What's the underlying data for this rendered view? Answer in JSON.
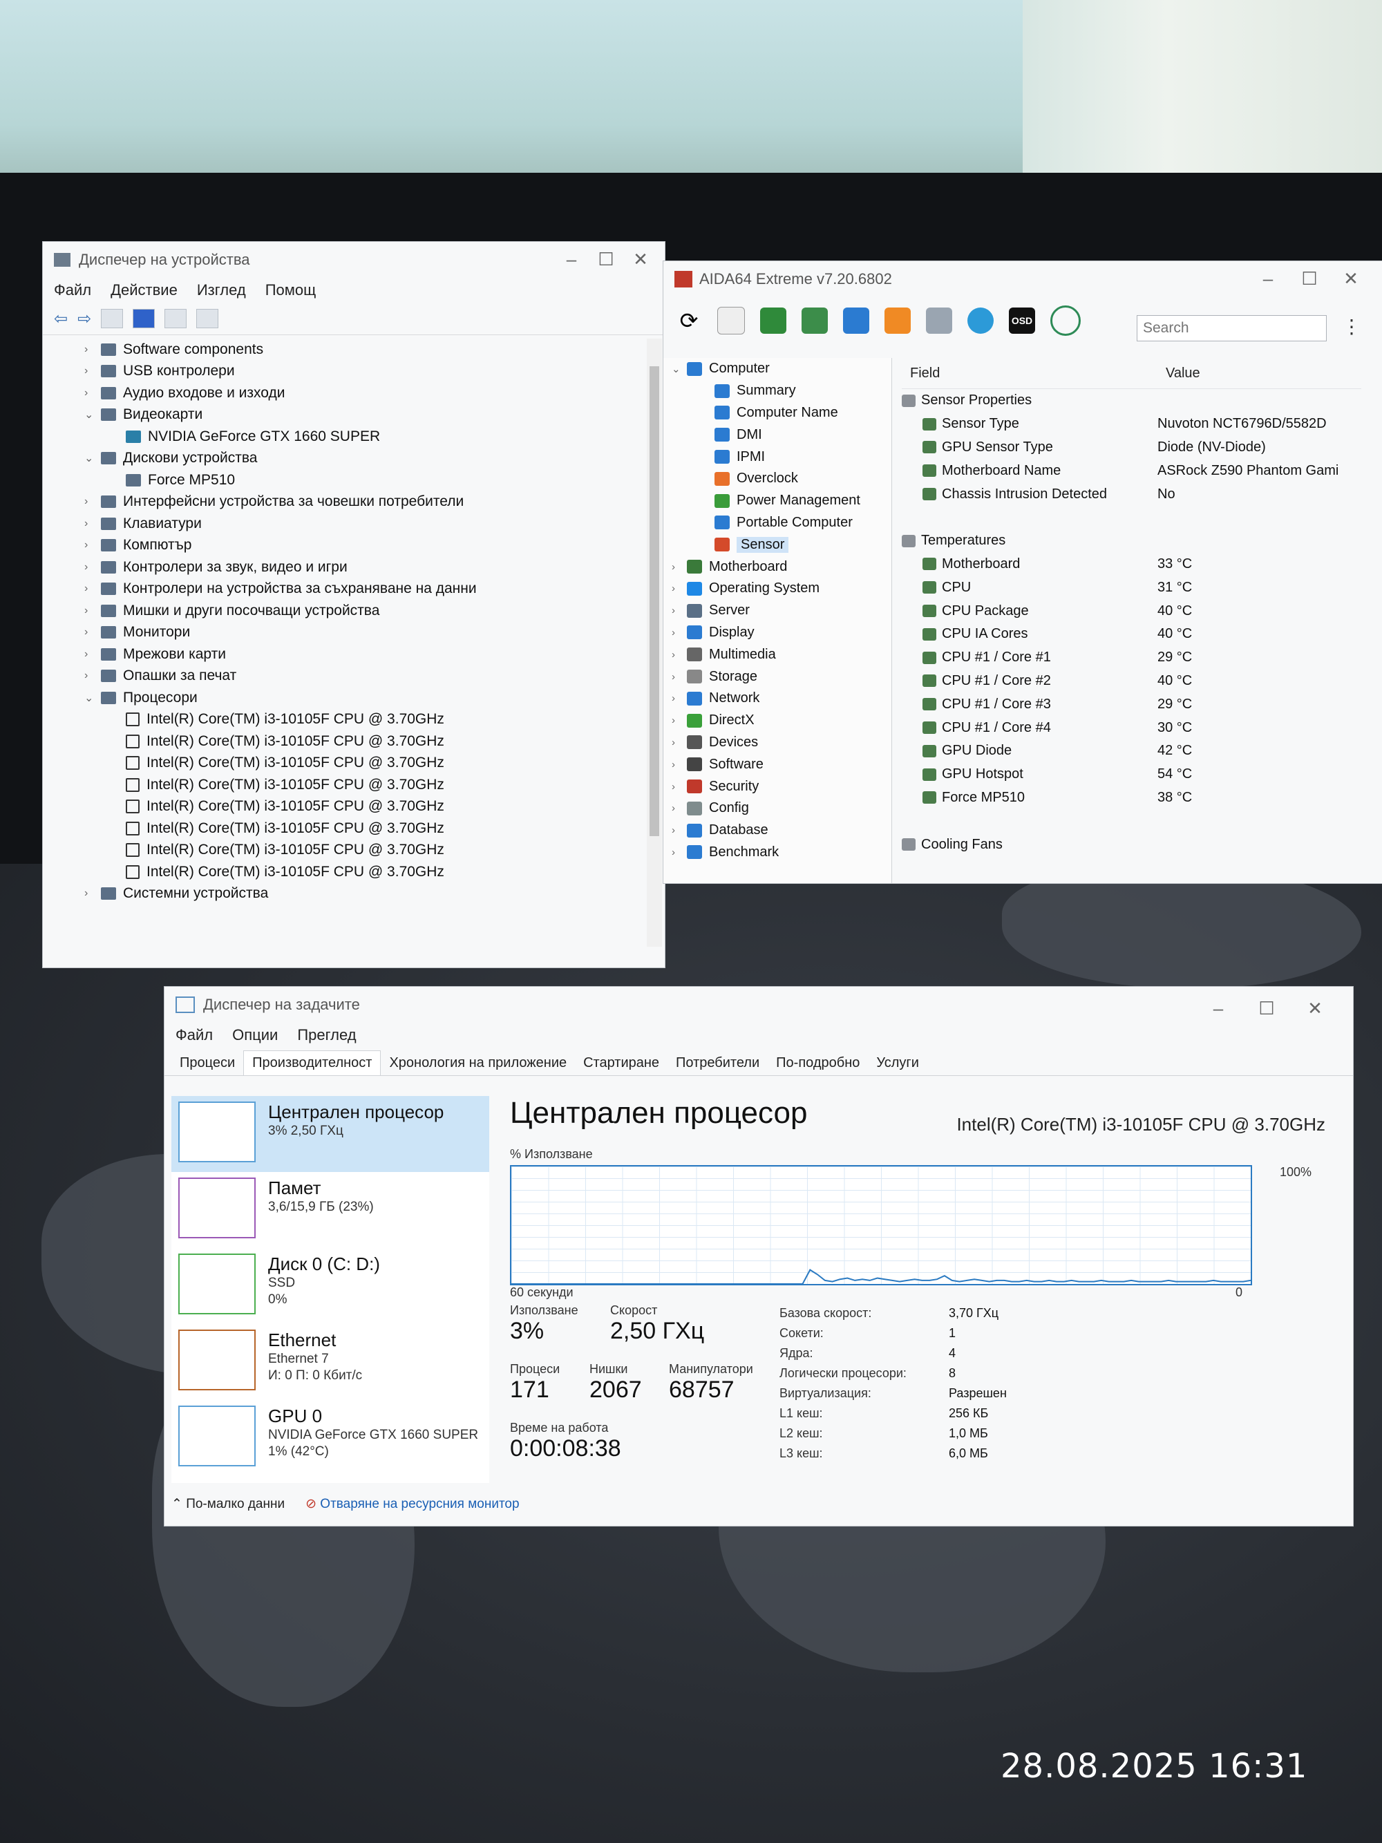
{
  "device_manager": {
    "title": "Диспечер на устройства",
    "menu": [
      "Файл",
      "Действие",
      "Изглед",
      "Помощ"
    ],
    "tree": [
      {
        "label": "Software components",
        "level": 0,
        "expanded": false
      },
      {
        "label": "USB контролери",
        "level": 0,
        "expanded": false
      },
      {
        "label": "Аудио входове и изходи",
        "level": 0,
        "expanded": false
      },
      {
        "label": "Видеокарти",
        "level": 0,
        "expanded": true
      },
      {
        "label": "NVIDIA GeForce GTX 1660 SUPER",
        "level": 1
      },
      {
        "label": "Дискови устройства",
        "level": 0,
        "expanded": true
      },
      {
        "label": "Force MP510",
        "level": 1
      },
      {
        "label": "Интерфейсни устройства за човешки потребители",
        "level": 0,
        "expanded": false
      },
      {
        "label": "Клавиатури",
        "level": 0,
        "expanded": false
      },
      {
        "label": "Компютър",
        "level": 0,
        "expanded": false
      },
      {
        "label": "Контролери за звук, видео и игри",
        "level": 0,
        "expanded": false
      },
      {
        "label": "Контролери на устройства за съхраняване на данни",
        "level": 0,
        "expanded": false
      },
      {
        "label": "Мишки и други посочващи устройства",
        "level": 0,
        "expanded": false
      },
      {
        "label": "Монитори",
        "level": 0,
        "expanded": false
      },
      {
        "label": "Мрежови карти",
        "level": 0,
        "expanded": false
      },
      {
        "label": "Опашки за печат",
        "level": 0,
        "expanded": false
      },
      {
        "label": "Процесори",
        "level": 0,
        "expanded": true
      },
      {
        "label": "Intel(R) Core(TM) i3-10105F CPU @ 3.70GHz",
        "level": 1
      },
      {
        "label": "Intel(R) Core(TM) i3-10105F CPU @ 3.70GHz",
        "level": 1
      },
      {
        "label": "Intel(R) Core(TM) i3-10105F CPU @ 3.70GHz",
        "level": 1
      },
      {
        "label": "Intel(R) Core(TM) i3-10105F CPU @ 3.70GHz",
        "level": 1
      },
      {
        "label": "Intel(R) Core(TM) i3-10105F CPU @ 3.70GHz",
        "level": 1
      },
      {
        "label": "Intel(R) Core(TM) i3-10105F CPU @ 3.70GHz",
        "level": 1
      },
      {
        "label": "Intel(R) Core(TM) i3-10105F CPU @ 3.70GHz",
        "level": 1
      },
      {
        "label": "Intel(R) Core(TM) i3-10105F CPU @ 3.70GHz",
        "level": 1
      },
      {
        "label": "Системни устройства",
        "level": 0,
        "expanded": false
      }
    ]
  },
  "aida": {
    "title": "AIDA64 Extreme v7.20.6802",
    "search_placeholder": "Search",
    "toolbar_osd": "OSD",
    "tree": [
      {
        "label": "Computer",
        "level": 0,
        "expanded": true,
        "color": "#2b7bd1"
      },
      {
        "label": "Summary",
        "level": 1,
        "color": "#2b7bd1"
      },
      {
        "label": "Computer Name",
        "level": 1,
        "color": "#2b7bd1"
      },
      {
        "label": "DMI",
        "level": 1,
        "color": "#2b7bd1"
      },
      {
        "label": "IPMI",
        "level": 1,
        "color": "#2b7bd1"
      },
      {
        "label": "Overclock",
        "level": 1,
        "color": "#e8702a"
      },
      {
        "label": "Power Management",
        "level": 1,
        "color": "#3a9c3a"
      },
      {
        "label": "Portable Computer",
        "level": 1,
        "color": "#2b7bd1"
      },
      {
        "label": "Sensor",
        "level": 1,
        "color": "#d44a2a",
        "selected": true
      },
      {
        "label": "Motherboard",
        "level": 0,
        "color": "#3a7a3a"
      },
      {
        "label": "Operating System",
        "level": 0,
        "color": "#1e88e5"
      },
      {
        "label": "Server",
        "level": 0,
        "color": "#5a6f86"
      },
      {
        "label": "Display",
        "level": 0,
        "color": "#2b7bd1"
      },
      {
        "label": "Multimedia",
        "level": 0,
        "color": "#666666"
      },
      {
        "label": "Storage",
        "level": 0,
        "color": "#888888"
      },
      {
        "label": "Network",
        "level": 0,
        "color": "#2b7bd1"
      },
      {
        "label": "DirectX",
        "level": 0,
        "color": "#3aa03a"
      },
      {
        "label": "Devices",
        "level": 0,
        "color": "#555555"
      },
      {
        "label": "Software",
        "level": 0,
        "color": "#444444"
      },
      {
        "label": "Security",
        "level": 0,
        "color": "#c0392b"
      },
      {
        "label": "Config",
        "level": 0,
        "color": "#7f8c8d"
      },
      {
        "label": "Database",
        "level": 0,
        "color": "#2b7bd1"
      },
      {
        "label": "Benchmark",
        "level": 0,
        "color": "#2b7bd1"
      }
    ],
    "grid_headers": {
      "field": "Field",
      "value": "Value"
    },
    "grid": [
      {
        "type": "group",
        "field": "Sensor Properties",
        "value": ""
      },
      {
        "type": "row",
        "field": "Sensor Type",
        "value": "Nuvoton NCT6796D/5582D"
      },
      {
        "type": "row",
        "field": "GPU Sensor Type",
        "value": "Diode  (NV-Diode)"
      },
      {
        "type": "row",
        "field": "Motherboard Name",
        "value": "ASRock Z590 Phantom Gami"
      },
      {
        "type": "row",
        "field": "Chassis Intrusion Detected",
        "value": "No"
      },
      {
        "type": "spacer",
        "field": "",
        "value": ""
      },
      {
        "type": "group",
        "field": "Temperatures",
        "value": ""
      },
      {
        "type": "row",
        "field": "Motherboard",
        "value": "33 °C"
      },
      {
        "type": "row",
        "field": "CPU",
        "value": "31 °C"
      },
      {
        "type": "row",
        "field": "CPU Package",
        "value": "40 °C"
      },
      {
        "type": "row",
        "field": "CPU IA Cores",
        "value": "40 °C"
      },
      {
        "type": "row",
        "field": "CPU #1 / Core #1",
        "value": "29 °C"
      },
      {
        "type": "row",
        "field": "CPU #1 / Core #2",
        "value": "40 °C"
      },
      {
        "type": "row",
        "field": "CPU #1 / Core #3",
        "value": "29 °C"
      },
      {
        "type": "row",
        "field": "CPU #1 / Core #4",
        "value": "30 °C"
      },
      {
        "type": "row",
        "field": "GPU Diode",
        "value": "42 °C"
      },
      {
        "type": "row",
        "field": "GPU Hotspot",
        "value": "54 °C"
      },
      {
        "type": "row",
        "field": "Force MP510",
        "value": "38 °C"
      },
      {
        "type": "spacer",
        "field": "",
        "value": ""
      },
      {
        "type": "group",
        "field": "Cooling Fans",
        "value": ""
      }
    ]
  },
  "task_manager": {
    "title": "Диспечер на задачите",
    "menu": [
      "Файл",
      "Опции",
      "Преглед"
    ],
    "tabs": [
      "Процеси",
      "Производителност",
      "Хронология на приложение",
      "Стартиране",
      "Потребители",
      "По-подробно",
      "Услуги"
    ],
    "sidebar": [
      {
        "name": "Централен процесор",
        "line2": "3% 2,50 ГХц",
        "line3": "",
        "active": true,
        "color": "#5aa0d6"
      },
      {
        "name": "Памет",
        "line2": "3,6/15,9 ГБ (23%)",
        "line3": "",
        "active": false,
        "color": "#9b59b6"
      },
      {
        "name": "Диск 0 (C: D:)",
        "line2": "SSD",
        "line3": "0%",
        "active": false,
        "color": "#4caf50"
      },
      {
        "name": "Ethernet",
        "line2": "Ethernet 7",
        "line3": "И: 0 П: 0 Кбит/с",
        "active": false,
        "color": "#b7652a"
      },
      {
        "name": "GPU 0",
        "line2": "NVIDIA GeForce GTX 1660 SUPER",
        "line3": "1% (42°C)",
        "active": false,
        "color": "#5aa0d6"
      }
    ],
    "main_title": "Централен процесор",
    "cpu_name": "Intel(R) Core(TM) i3-10105F CPU @ 3.70GHz",
    "graph_label": "% Използване",
    "graph_max": "100%",
    "graph_window": "60 секунди",
    "graph_zero": "0",
    "usage_series": [
      0,
      0,
      0,
      0,
      0,
      0,
      0,
      0,
      0,
      0,
      0,
      0,
      0,
      0,
      0,
      0,
      0,
      0,
      0,
      0,
      0,
      0,
      0,
      0,
      0,
      0,
      0,
      0,
      0,
      0,
      0,
      0,
      0,
      0,
      0,
      0,
      0,
      0,
      0,
      0,
      12,
      8,
      3,
      2,
      4,
      5,
      3,
      4,
      3,
      5,
      4,
      3,
      2,
      3,
      4,
      3,
      3,
      4,
      7,
      3,
      2,
      3,
      4,
      3,
      2,
      3,
      3,
      2,
      2,
      3,
      2,
      2,
      3,
      2,
      2,
      3,
      2,
      2,
      2,
      3,
      2,
      2,
      2,
      3,
      2,
      2,
      2,
      2,
      3,
      2,
      2,
      2,
      2,
      2,
      3,
      2,
      2,
      2,
      2,
      3
    ],
    "stats": {
      "usage_label": "Използване",
      "usage": "3%",
      "speed_label": "Скорост",
      "speed": "2,50 ГХц",
      "processes_label": "Процеси",
      "processes": "171",
      "threads_label": "Нишки",
      "threads": "2067",
      "handles_label": "Манипулатори",
      "handles": "68757",
      "uptime_label": "Време на работа",
      "uptime": "0:00:08:38"
    },
    "details": [
      {
        "k": "Базова скорост:",
        "v": "3,70 ГХц"
      },
      {
        "k": "Сокети:",
        "v": "1"
      },
      {
        "k": "Ядра:",
        "v": "4"
      },
      {
        "k": "Логически процесори:",
        "v": "8"
      },
      {
        "k": "Виртуализация:",
        "v": "Разрешен"
      },
      {
        "k": "L1 кеш:",
        "v": "256 КБ"
      },
      {
        "k": "L2 кеш:",
        "v": "1,0 МБ"
      },
      {
        "k": "L3 кеш:",
        "v": "6,0 МБ"
      }
    ],
    "footer_less": "По-малко данни",
    "footer_link": "Отваряне на ресурсния монитор"
  },
  "photo_timestamp": "28.08.2025 16:31"
}
